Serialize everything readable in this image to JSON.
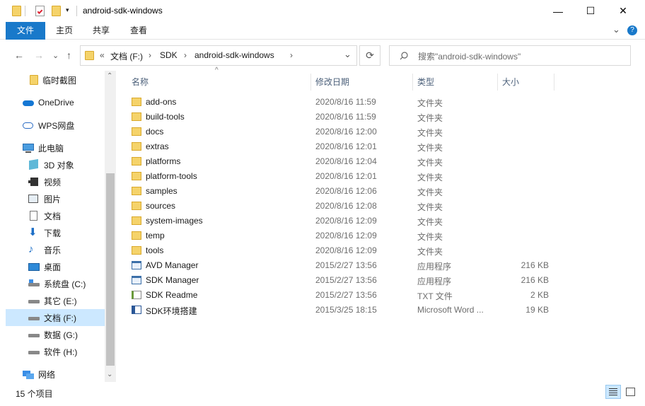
{
  "window": {
    "title": "android-sdk-windows",
    "minimize": "—",
    "maximize": "☐",
    "close": "✕"
  },
  "ribbon": {
    "tabs": [
      "文件",
      "主页",
      "共享",
      "查看"
    ],
    "collapse": "⌄",
    "help": "?"
  },
  "nav": {
    "back": "←",
    "forward": "→",
    "recent": "⌄",
    "up": "↑",
    "breadcrumb_overflow": "«",
    "breadcrumbs": [
      "文档 (F:)",
      "SDK",
      "android-sdk-windows"
    ],
    "sep": "›",
    "dropdown": "⌄",
    "refresh": "⟳",
    "search_placeholder": "搜索\"android-sdk-windows\""
  },
  "sidebar": {
    "items": [
      {
        "label": "临时截图",
        "icon": "folder-icon"
      },
      {
        "label": "OneDrive",
        "icon": "onedrive-cloud-icon"
      },
      {
        "label": "WPS网盘",
        "icon": "wps-cloud-icon"
      },
      {
        "label": "此电脑",
        "icon": "this-pc-icon"
      },
      {
        "label": "3D 对象",
        "icon": "3d-objects-icon"
      },
      {
        "label": "视频",
        "icon": "videos-icon"
      },
      {
        "label": "图片",
        "icon": "pictures-icon"
      },
      {
        "label": "文档",
        "icon": "documents-icon"
      },
      {
        "label": "下载",
        "icon": "downloads-icon"
      },
      {
        "label": "音乐",
        "icon": "music-icon"
      },
      {
        "label": "桌面",
        "icon": "desktop-icon"
      },
      {
        "label": "系统盘 (C:)",
        "icon": "system-drive-icon"
      },
      {
        "label": "其它 (E:)",
        "icon": "drive-icon"
      },
      {
        "label": "文档 (F:)",
        "icon": "drive-icon",
        "selected": true
      },
      {
        "label": "数据 (G:)",
        "icon": "drive-icon"
      },
      {
        "label": "软件 (H:)",
        "icon": "drive-icon"
      },
      {
        "label": "网络",
        "icon": "network-icon"
      }
    ],
    "scroll_up": "⌃",
    "scroll_down": "⌄"
  },
  "columns": {
    "name": "名称",
    "date": "修改日期",
    "type": "类型",
    "size": "大小",
    "sort_indicator": "^"
  },
  "files": [
    {
      "name": "add-ons",
      "date": "2020/8/16 11:59",
      "type": "文件夹",
      "size": "",
      "icon": "folder-icon"
    },
    {
      "name": "build-tools",
      "date": "2020/8/16 11:59",
      "type": "文件夹",
      "size": "",
      "icon": "folder-icon"
    },
    {
      "name": "docs",
      "date": "2020/8/16 12:00",
      "type": "文件夹",
      "size": "",
      "icon": "folder-icon"
    },
    {
      "name": "extras",
      "date": "2020/8/16 12:01",
      "type": "文件夹",
      "size": "",
      "icon": "folder-icon"
    },
    {
      "name": "platforms",
      "date": "2020/8/16 12:04",
      "type": "文件夹",
      "size": "",
      "icon": "folder-icon"
    },
    {
      "name": "platform-tools",
      "date": "2020/8/16 12:01",
      "type": "文件夹",
      "size": "",
      "icon": "folder-icon"
    },
    {
      "name": "samples",
      "date": "2020/8/16 12:06",
      "type": "文件夹",
      "size": "",
      "icon": "folder-icon"
    },
    {
      "name": "sources",
      "date": "2020/8/16 12:08",
      "type": "文件夹",
      "size": "",
      "icon": "folder-icon"
    },
    {
      "name": "system-images",
      "date": "2020/8/16 12:09",
      "type": "文件夹",
      "size": "",
      "icon": "folder-icon"
    },
    {
      "name": "temp",
      "date": "2020/8/16 12:09",
      "type": "文件夹",
      "size": "",
      "icon": "folder-icon"
    },
    {
      "name": "tools",
      "date": "2020/8/16 12:09",
      "type": "文件夹",
      "size": "",
      "icon": "folder-icon"
    },
    {
      "name": "AVD Manager",
      "date": "2015/2/27 13:56",
      "type": "应用程序",
      "size": "216 KB",
      "icon": "application-icon"
    },
    {
      "name": "SDK Manager",
      "date": "2015/2/27 13:56",
      "type": "应用程序",
      "size": "216 KB",
      "icon": "application-icon"
    },
    {
      "name": "SDK Readme",
      "date": "2015/2/27 13:56",
      "type": "TXT 文件",
      "size": "2 KB",
      "icon": "text-file-icon"
    },
    {
      "name": "SDK环境搭建",
      "date": "2015/3/25 18:15",
      "type": "Microsoft Word ...",
      "size": "19 KB",
      "icon": "word-document-icon"
    }
  ],
  "status": {
    "item_count": "15 个项目"
  },
  "colors": {
    "accent": "#1979ca",
    "selection": "#cce8ff",
    "folder": "#f5d36a"
  }
}
